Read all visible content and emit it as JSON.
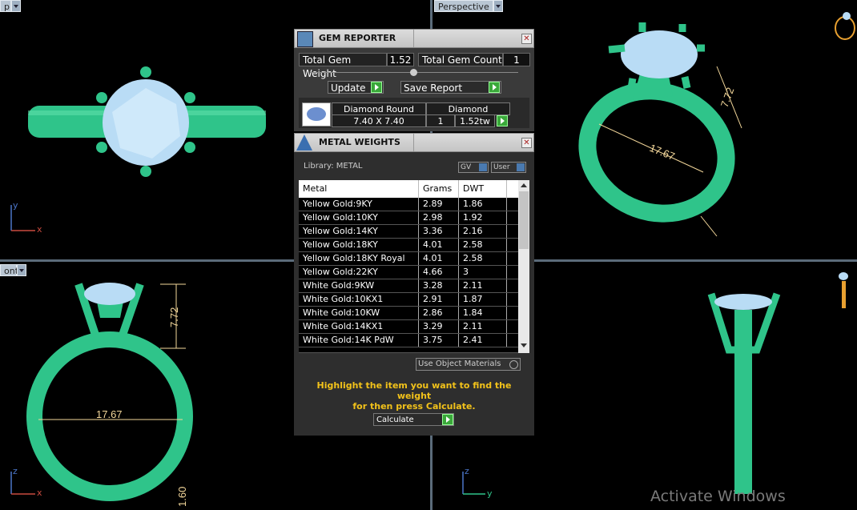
{
  "viewports": {
    "top_left_label": "p",
    "top_right_label": "Perspective",
    "bottom_left_label": "ont",
    "dimensions": {
      "width": "17.67",
      "height": "7.72",
      "small": "1.60"
    }
  },
  "axes": {
    "x": "x",
    "y": "y",
    "z": "z"
  },
  "gem_reporter": {
    "title": "GEM REPORTER",
    "total_gem_weight_label": "Total Gem Weight",
    "total_gem_weight_value": "1.52",
    "total_gem_count_label": "Total Gem Count",
    "total_gem_count_value": "1",
    "update_label": "Update",
    "save_report_label": "Save Report",
    "gem": {
      "name": "Diamond Round",
      "size": "7.40 X 7.40",
      "material": "Diamond",
      "count": "1",
      "weight": "1.52tw"
    }
  },
  "metal_weights": {
    "title": "METAL WEIGHTS",
    "library_label": "Library: METAL",
    "gv_label": "GV",
    "user_label": "User",
    "columns": [
      "Metal",
      "Grams",
      "DWT"
    ],
    "rows": [
      [
        "Yellow Gold:9KY",
        "2.89",
        "1.86"
      ],
      [
        "Yellow Gold:10KY",
        "2.98",
        "1.92"
      ],
      [
        "Yellow Gold:14KY",
        "3.36",
        "2.16"
      ],
      [
        "Yellow Gold:18KY",
        "4.01",
        "2.58"
      ],
      [
        "Yellow Gold:18KY Royal",
        "4.01",
        "2.58"
      ],
      [
        "Yellow Gold:22KY",
        "4.66",
        "3"
      ],
      [
        "White Gold:9KW",
        "3.28",
        "2.11"
      ],
      [
        "White Gold:10KX1",
        "2.91",
        "1.87"
      ],
      [
        "White Gold:10KW",
        "2.86",
        "1.84"
      ],
      [
        "White Gold:14KX1",
        "3.29",
        "2.11"
      ],
      [
        "White Gold:14K PdW",
        "3.75",
        "2.41"
      ]
    ],
    "use_object_materials_label": "Use Object Materials",
    "hint_line1": "Highlight the item you want to find the weight",
    "hint_line2": "for then press Calculate.",
    "calculate_label": "Calculate"
  },
  "watermark": "Activate Windows",
  "colors": {
    "ring": "#2fc48a",
    "gem": "#b9dcf5",
    "hint": "#f2c21a"
  }
}
